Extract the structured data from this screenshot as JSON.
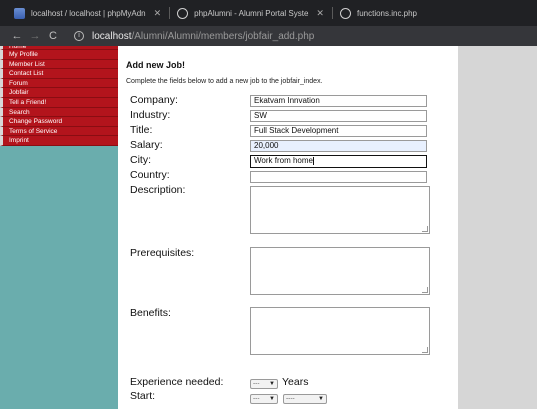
{
  "browser": {
    "tabs": [
      {
        "title": "localhost / localhost | phpMyAdn",
        "icon": "phpmyadmin-icon"
      },
      {
        "title": "phpAlumni - Alumni Portal Syste",
        "icon": "globe-icon"
      },
      {
        "title": "functions.inc.php",
        "icon": "globe-icon"
      }
    ],
    "close_glyph": "✕",
    "url_host": "localhost",
    "url_path": "/Alumni/Alumni/members/jobfair_add.php"
  },
  "sidebar": {
    "items": [
      {
        "label": "Home"
      },
      {
        "label": "My Profile"
      },
      {
        "label": "Member List"
      },
      {
        "label": "Contact List"
      },
      {
        "label": "Forum"
      },
      {
        "label": "Jobfair"
      },
      {
        "label": "Tell a Friend!"
      },
      {
        "label": "Search"
      },
      {
        "label": "Change Password"
      },
      {
        "label": "Terms of Service"
      },
      {
        "label": "Imprint"
      }
    ]
  },
  "form": {
    "heading": "Add new Job!",
    "intro": "Complete the fields below to add a new job to the jobfair_index.",
    "fields": {
      "company": {
        "label": "Company:",
        "value": "Ekatvam Innvation"
      },
      "industry": {
        "label": "Industry:",
        "value": "SW"
      },
      "title": {
        "label": "Title:",
        "value": "Full Stack Development"
      },
      "salary": {
        "label": "Salary:",
        "value": "20,000"
      },
      "city": {
        "label": "City:",
        "value": "Work from home"
      },
      "country": {
        "label": "Country:",
        "value": ""
      },
      "description": {
        "label": "Description:"
      },
      "prerequisites": {
        "label": "Prerequisites:"
      },
      "benefits": {
        "label": "Benefits:"
      },
      "experience": {
        "label": "Experience needed:",
        "selected": "---",
        "unit": "Years"
      },
      "start": {
        "label": "Start:",
        "month": "---",
        "day": "----"
      }
    }
  }
}
